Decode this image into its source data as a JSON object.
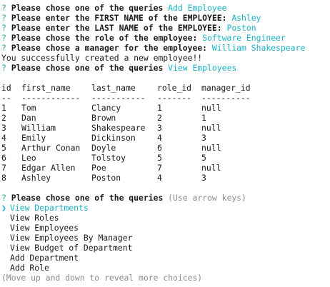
{
  "history": [
    {
      "prompt": "Please chose one of the queries",
      "answer": "Add Employee"
    },
    {
      "prompt": "Please enter the FIRST NAME of the EMPLOYEE:",
      "answer": "Ashley"
    },
    {
      "prompt": "Please enter the LAST NAME of the EMPLOYEE:",
      "answer": "Poston"
    },
    {
      "prompt": "Please chose the role of the employee:",
      "answer": "Software Engineer"
    },
    {
      "prompt": "Please chose a manager for the employee:",
      "answer": "William Shakespeare"
    }
  ],
  "success_message": "You successfully created a new employee!!",
  "second_query": {
    "prompt": "Please chose one of the queries",
    "answer": "View Employees"
  },
  "question_mark": "?",
  "table": {
    "headers": [
      "id",
      "first_name",
      "last_name",
      "role_id",
      "manager_id"
    ],
    "separators": [
      "--",
      "------------",
      "-----------",
      "-------",
      "----------"
    ],
    "rows": [
      [
        "1",
        "Tom",
        "Clancy",
        "1",
        "null"
      ],
      [
        "2",
        "Dan",
        "Brown",
        "2",
        "1"
      ],
      [
        "3",
        "William",
        "Shakespeare",
        "3",
        "null"
      ],
      [
        "4",
        "Emily",
        "Dickinson",
        "4",
        "3"
      ],
      [
        "5",
        "Arthur Conan",
        "Doyle",
        "6",
        "null"
      ],
      [
        "6",
        "Leo",
        "Tolstoy",
        "5",
        "5"
      ],
      [
        "7",
        "Edgar Allen",
        "Poe",
        "7",
        "null"
      ],
      [
        "8",
        "Ashley",
        "Poston",
        "4",
        "3"
      ]
    ]
  },
  "active_query": {
    "prompt": "Please chose one of the queries",
    "hint": "(Use arrow keys)",
    "pointer": "❯",
    "choices": [
      "View Departments",
      "View Roles",
      "View Employees",
      "View Employees By Manager",
      "View Budget of Department",
      "Add Department",
      "Add Role"
    ],
    "selected_index": 0,
    "footer": "(Move up and down to reveal more choices)"
  },
  "colors": {
    "question": "#2aa198",
    "answer": "#17b1c9",
    "hint": "#8a8a8a"
  }
}
